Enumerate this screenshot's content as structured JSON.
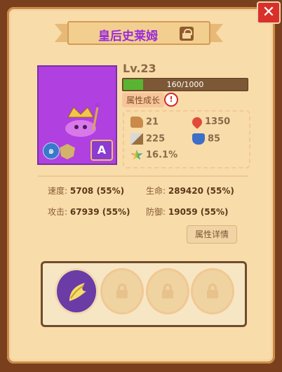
{
  "window": {
    "close_label": "✕"
  },
  "hero": {
    "name": "皇后史莱姆",
    "level": "Lv.23",
    "xp_text": "160/1000",
    "xp_fraction": 0.16,
    "grade": "A",
    "growth_label": "属性成长",
    "warning_glyph": "!"
  },
  "attributes": {
    "strength": "21",
    "hp_growth": "1350",
    "attack_growth": "225",
    "defense_growth": "85",
    "rate": "16.1%"
  },
  "combat": {
    "speed_label": "速度:",
    "speed_value": "5708 (55%)",
    "hp_label": "生命:",
    "hp_value": "289420 (55%)",
    "attack_label": "攻击:",
    "attack_value": "67939 (55%)",
    "defense_label": "防御:",
    "defense_value": "19059 (55%)"
  },
  "buttons": {
    "details": "属性详情"
  },
  "colors": {
    "accent_purple": "#9a2cd8",
    "xp_green": "#58b431",
    "panel": "#f8dcaa"
  },
  "icons": [
    "close-icon",
    "lock-icon",
    "water-rune-icon",
    "shield-icon",
    "boot-icon",
    "heart-icon",
    "sword-icon",
    "armor-icon",
    "star-icon",
    "feather-skill-icon"
  ]
}
